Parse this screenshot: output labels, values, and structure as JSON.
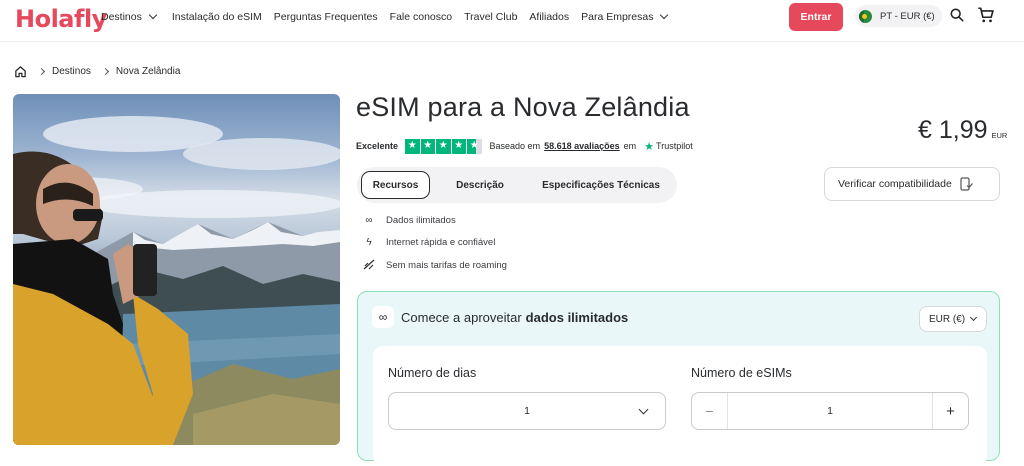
{
  "header": {
    "logo": "Holafly",
    "nav": [
      {
        "label": "Destinos",
        "dropdown": true
      },
      {
        "label": "Instalação do eSIM",
        "dropdown": false
      },
      {
        "label": "Perguntas Frequentes",
        "dropdown": false
      },
      {
        "label": "Fale conosco",
        "dropdown": false
      },
      {
        "label": "Travel Club",
        "dropdown": false
      },
      {
        "label": "Afiliados",
        "dropdown": false
      },
      {
        "label": "Para Empresas",
        "dropdown": true
      }
    ],
    "login_label": "Entrar",
    "language_label": "PT - EUR (€)",
    "icons": [
      "search-icon",
      "cart-icon"
    ],
    "brand_color": "#e6485c"
  },
  "breadcrumb": {
    "items": [
      "Destinos",
      "Nova Zelândia"
    ],
    "home_icon": "home-icon"
  },
  "product": {
    "title": "eSIM para a Nova Zelândia",
    "price_main": "€ 1,99",
    "price_currency": "EUR",
    "rating_label": "Excelente",
    "rating_stars": 4.5,
    "based_on_prefix": "Baseado em",
    "reviews_count": "58.618 avaliações",
    "based_on_suffix": "em",
    "trustpilot": "Trustpilot"
  },
  "tabs": [
    "Recursos",
    "Descrição",
    "Especificações Técnicas"
  ],
  "active_tab": "Recursos",
  "compat_label": "Verificar compatibilidade",
  "features": [
    {
      "icon": "infinity-icon",
      "label": "Dados ilimitados"
    },
    {
      "icon": "lightning-icon",
      "label": "Internet rápida e confiável"
    },
    {
      "icon": "no-roaming-icon",
      "label": "Sem mais tarifas de roaming"
    }
  ],
  "plan_card": {
    "heading_prefix": "Comece a aproveitar",
    "heading_bold": "dados ilimitados",
    "currency_select": "EUR (€)",
    "days_label": "Número de dias",
    "days_value": "1",
    "esims_label": "Número de eSIMs",
    "esims_value": "1",
    "minus": "−",
    "plus": "+",
    "accent_border": "#8be0b5",
    "background": "#eaf7f9"
  }
}
